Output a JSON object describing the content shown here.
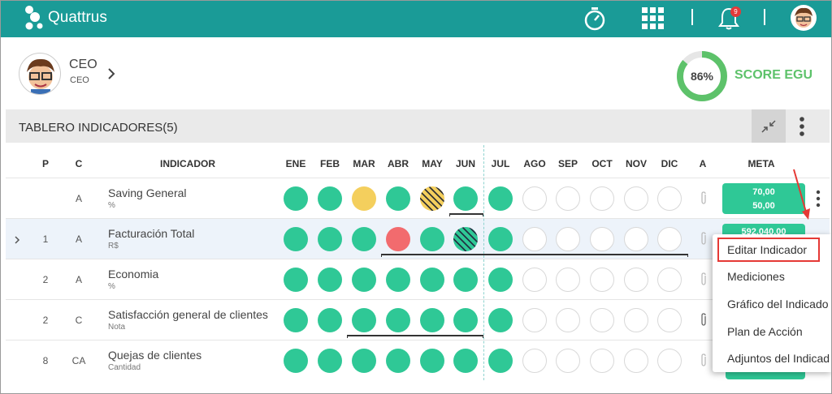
{
  "app": {
    "brand": "Quattrus",
    "notifications": "9"
  },
  "user": {
    "name": "CEO",
    "role": "CEO"
  },
  "score": {
    "value": "86%",
    "percent": 86,
    "label": "SCORE EGU",
    "color": "#5dc26a"
  },
  "panel": {
    "title": "TABLERO INDICADORES(5)"
  },
  "columns": {
    "p": "P",
    "c": "C",
    "indicador": "INDICADOR",
    "a": "A",
    "meta": "META",
    "months": [
      "ENE",
      "FEB",
      "MAR",
      "ABR",
      "MAY",
      "JUN",
      "JUL",
      "AGO",
      "SEP",
      "OCT",
      "NOV",
      "DIC"
    ]
  },
  "rows": [
    {
      "p": "",
      "c": "A",
      "name": "Saving General",
      "unit": "%",
      "meta1": "70,00",
      "meta2": "50,00",
      "status": [
        "green",
        "green",
        "yellow",
        "green",
        "hatch-y",
        "green",
        "green",
        "empty",
        "empty",
        "empty",
        "empty",
        "empty"
      ]
    },
    {
      "p": "1",
      "c": "A",
      "name": "Facturación Total",
      "unit": "R$",
      "meta1": "592.040,00",
      "meta2": "",
      "status": [
        "green",
        "green",
        "green",
        "red",
        "green",
        "hatch-g",
        "green",
        "empty",
        "empty",
        "empty",
        "empty",
        "empty"
      ]
    },
    {
      "p": "2",
      "c": "A",
      "name": "Economia",
      "unit": "%",
      "meta1": "",
      "meta2": "",
      "status": [
        "green",
        "green",
        "green",
        "green",
        "green",
        "green",
        "green",
        "empty",
        "empty",
        "empty",
        "empty",
        "empty"
      ]
    },
    {
      "p": "2",
      "c": "C",
      "name": "Satisfacción general de clientes",
      "unit": "Nota",
      "meta1": "",
      "meta2": "",
      "status": [
        "green",
        "green",
        "green",
        "green",
        "green",
        "green",
        "green",
        "empty",
        "empty",
        "empty",
        "empty",
        "empty"
      ]
    },
    {
      "p": "8",
      "c": "CA",
      "name": "Quejas de clientes",
      "unit": "Cantidad",
      "meta1": "",
      "meta2": "",
      "status": [
        "green",
        "green",
        "green",
        "green",
        "green",
        "green",
        "green",
        "empty",
        "empty",
        "empty",
        "empty",
        "empty"
      ]
    }
  ],
  "menu": {
    "items": [
      "Editar Indicador",
      "Mediciones",
      "Gráfico del Indicado",
      "Plan de Acción",
      "Adjuntos del Indicad"
    ]
  },
  "colors": {
    "topbar": "#1a9b97",
    "green": "#2fc896",
    "yellow": "#f4cf5d",
    "red": "#f26b6e",
    "highlight": "#e53935"
  },
  "icons": [
    "logo-icon",
    "stopwatch-icon",
    "apps-grid-icon",
    "bell-icon",
    "avatar-icon",
    "chevron-right-icon",
    "collapse-icon",
    "more-vertical-icon",
    "paperclip-icon",
    "expand-row-icon"
  ]
}
